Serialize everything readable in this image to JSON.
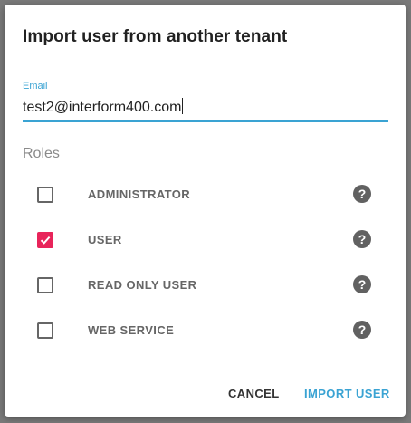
{
  "dialog": {
    "title": "Import user from another tenant",
    "email": {
      "label": "Email",
      "value": "test2@interform400.com"
    },
    "roles_label": "Roles",
    "roles": [
      {
        "name": "ADMINISTRATOR",
        "checked": false,
        "help_icon": "help-circle-icon",
        "help_glyph": "?"
      },
      {
        "name": "USER",
        "checked": true,
        "help_icon": "help-circle-icon",
        "help_glyph": "?"
      },
      {
        "name": "READ ONLY USER",
        "checked": false,
        "help_icon": "help-circle-icon",
        "help_glyph": "?"
      },
      {
        "name": "WEB SERVICE",
        "checked": false,
        "help_icon": "help-circle-icon",
        "help_glyph": "?"
      }
    ],
    "buttons": {
      "cancel": "CANCEL",
      "import": "IMPORT USER"
    }
  },
  "colors": {
    "accent": "#3aa3d3",
    "checked": "#e8245a",
    "backdrop": "#7a7a7a"
  }
}
